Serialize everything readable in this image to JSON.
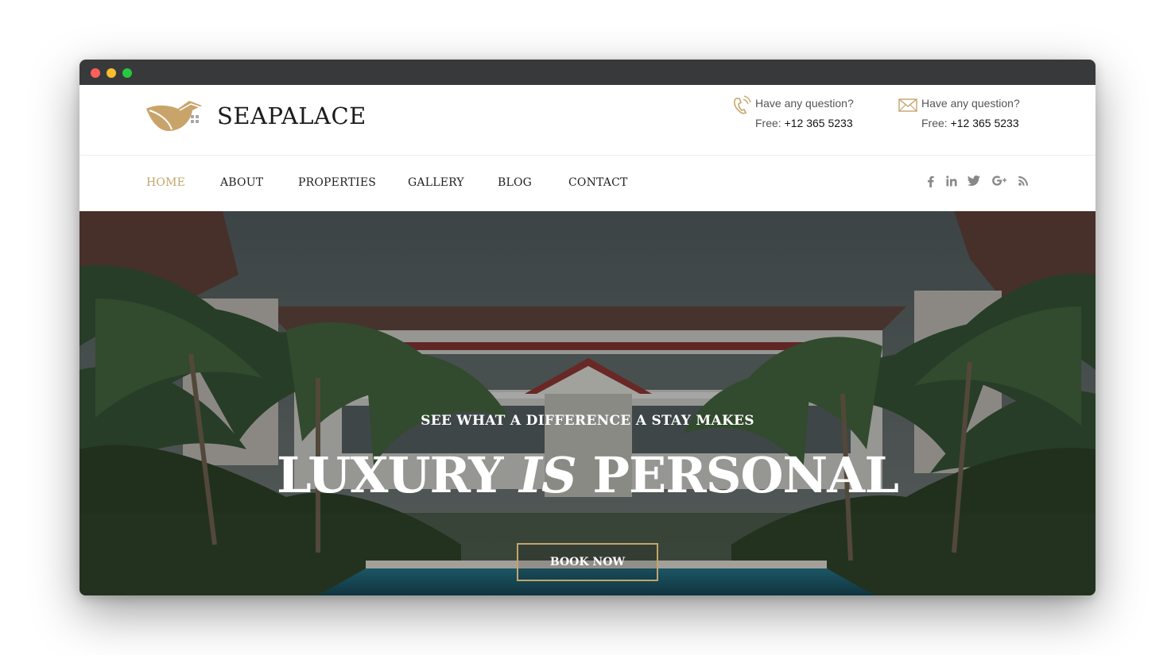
{
  "brand": {
    "name": "SEAPALACE",
    "accent_color": "#c5a46d"
  },
  "window": {
    "controls": [
      "close",
      "minimize",
      "maximize"
    ]
  },
  "header": {
    "contacts": [
      {
        "icon": "phone-icon",
        "question": "Have any question?",
        "free_label": "Free: ",
        "number": "+12 365 5233"
      },
      {
        "icon": "mail-icon",
        "question": "Have any question?",
        "free_label": "Free: ",
        "number": "+12 365 5233"
      }
    ]
  },
  "nav": {
    "items": [
      {
        "label": "HOME",
        "active": true
      },
      {
        "label": "ABOUT"
      },
      {
        "label": "PROPERTIES"
      },
      {
        "label": "GALLERY"
      },
      {
        "label": "BLOG"
      },
      {
        "label": "CONTACT"
      }
    ],
    "social": [
      "facebook-icon",
      "linkedin-icon",
      "twitter-icon",
      "google-plus-icon",
      "rss-icon"
    ]
  },
  "hero": {
    "eyebrow": "SEE WHAT A DIFFERENCE A STAY MAKES",
    "headline_part1": "LUXURY ",
    "headline_emphasis": "IS",
    "headline_part2": " PERSONAL",
    "cta_label": "BOOK NOW"
  }
}
